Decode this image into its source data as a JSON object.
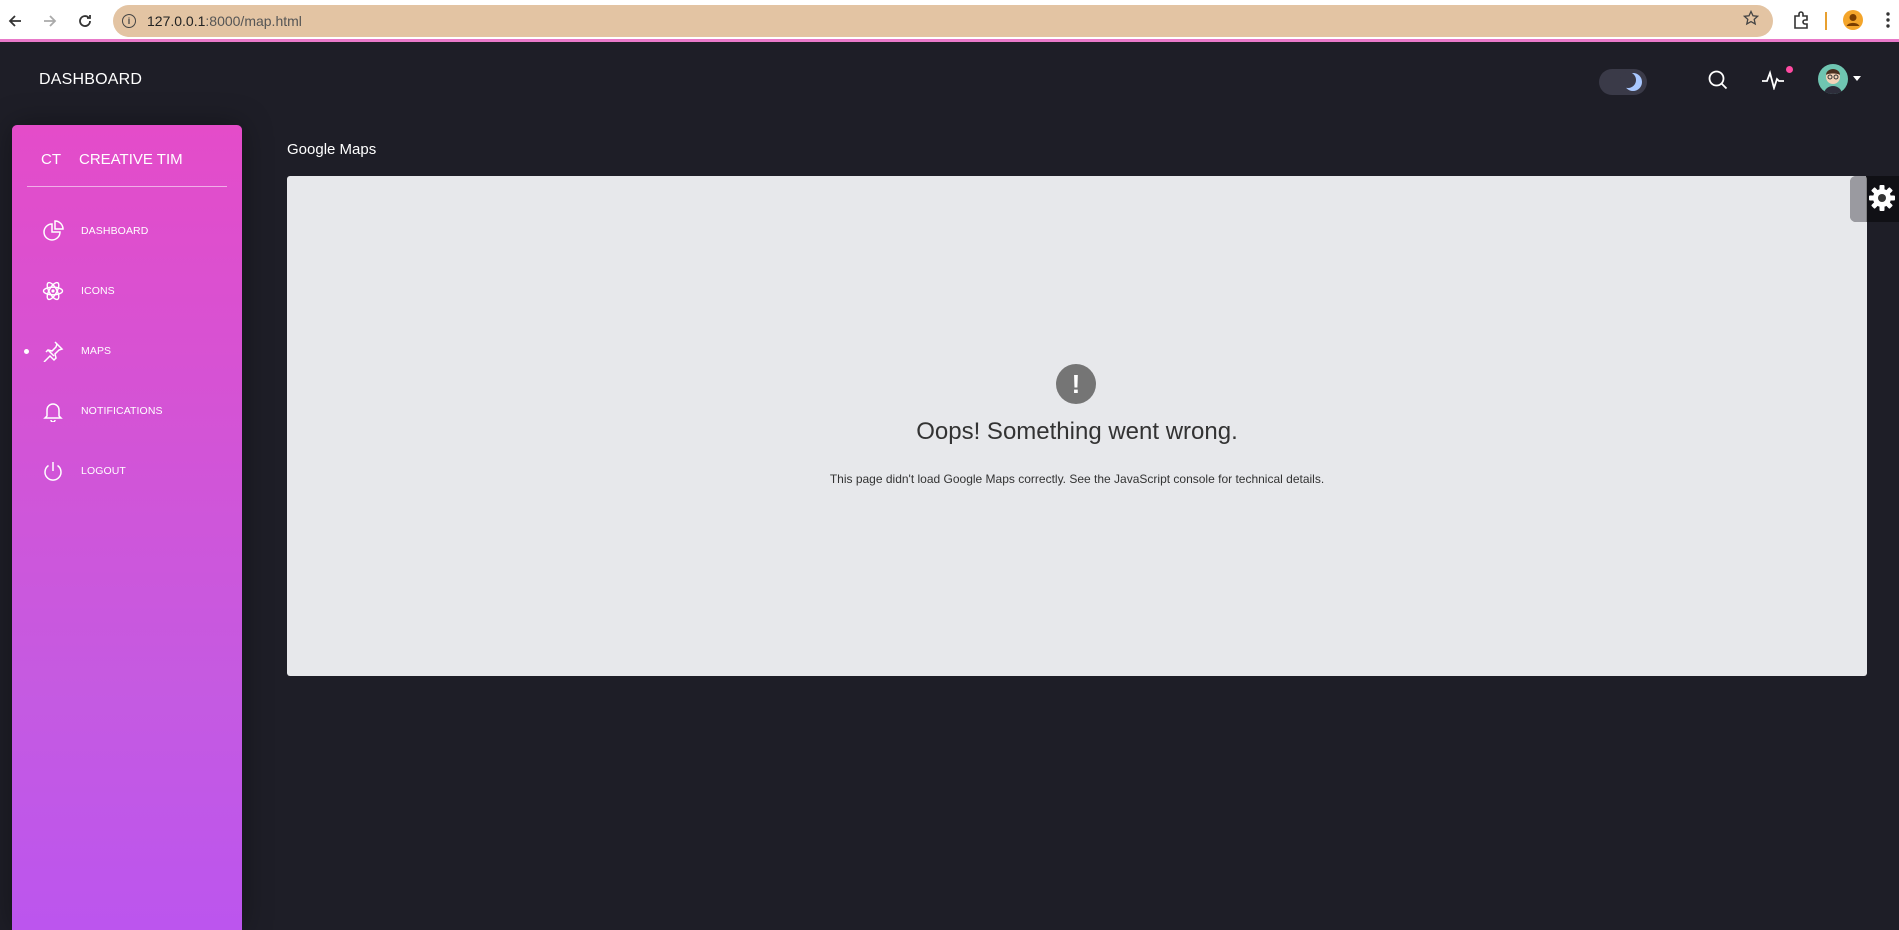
{
  "browser": {
    "url_host": "127.0.0.1",
    "url_rest": ":8000/map.html",
    "icons": [
      "back-icon",
      "forward-icon",
      "reload-icon",
      "site-info-icon",
      "bookmark-star-icon",
      "extensions-icon",
      "profile-icon",
      "menu-icon"
    ]
  },
  "navbar": {
    "brand": "DASHBOARD"
  },
  "sidebar": {
    "logo_mini": "CT",
    "logo_normal": "CREATIVE TIM",
    "items": [
      {
        "label": "DASHBOARD",
        "icon": "chart-pie-icon",
        "active": false
      },
      {
        "label": "ICONS",
        "icon": "atom-icon",
        "active": false
      },
      {
        "label": "MAPS",
        "icon": "pin-icon",
        "active": true
      },
      {
        "label": "NOTIFICATIONS",
        "icon": "bell-icon",
        "active": false
      },
      {
        "label": "LOGOUT",
        "icon": "power-icon",
        "active": false
      }
    ]
  },
  "main": {
    "title": "Google Maps",
    "error_icon": "!",
    "error_title": "Oops! Something went wrong.",
    "error_message": "This page didn't load Google Maps correctly. See the JavaScript console for technical details."
  },
  "colors": {
    "background": "#1e1e27",
    "sidebar_top": "#e44cc9",
    "sidebar_bottom": "#bc55ee",
    "omnibox": "#e3c4a3",
    "notification_dot": "#ff4aa2"
  }
}
